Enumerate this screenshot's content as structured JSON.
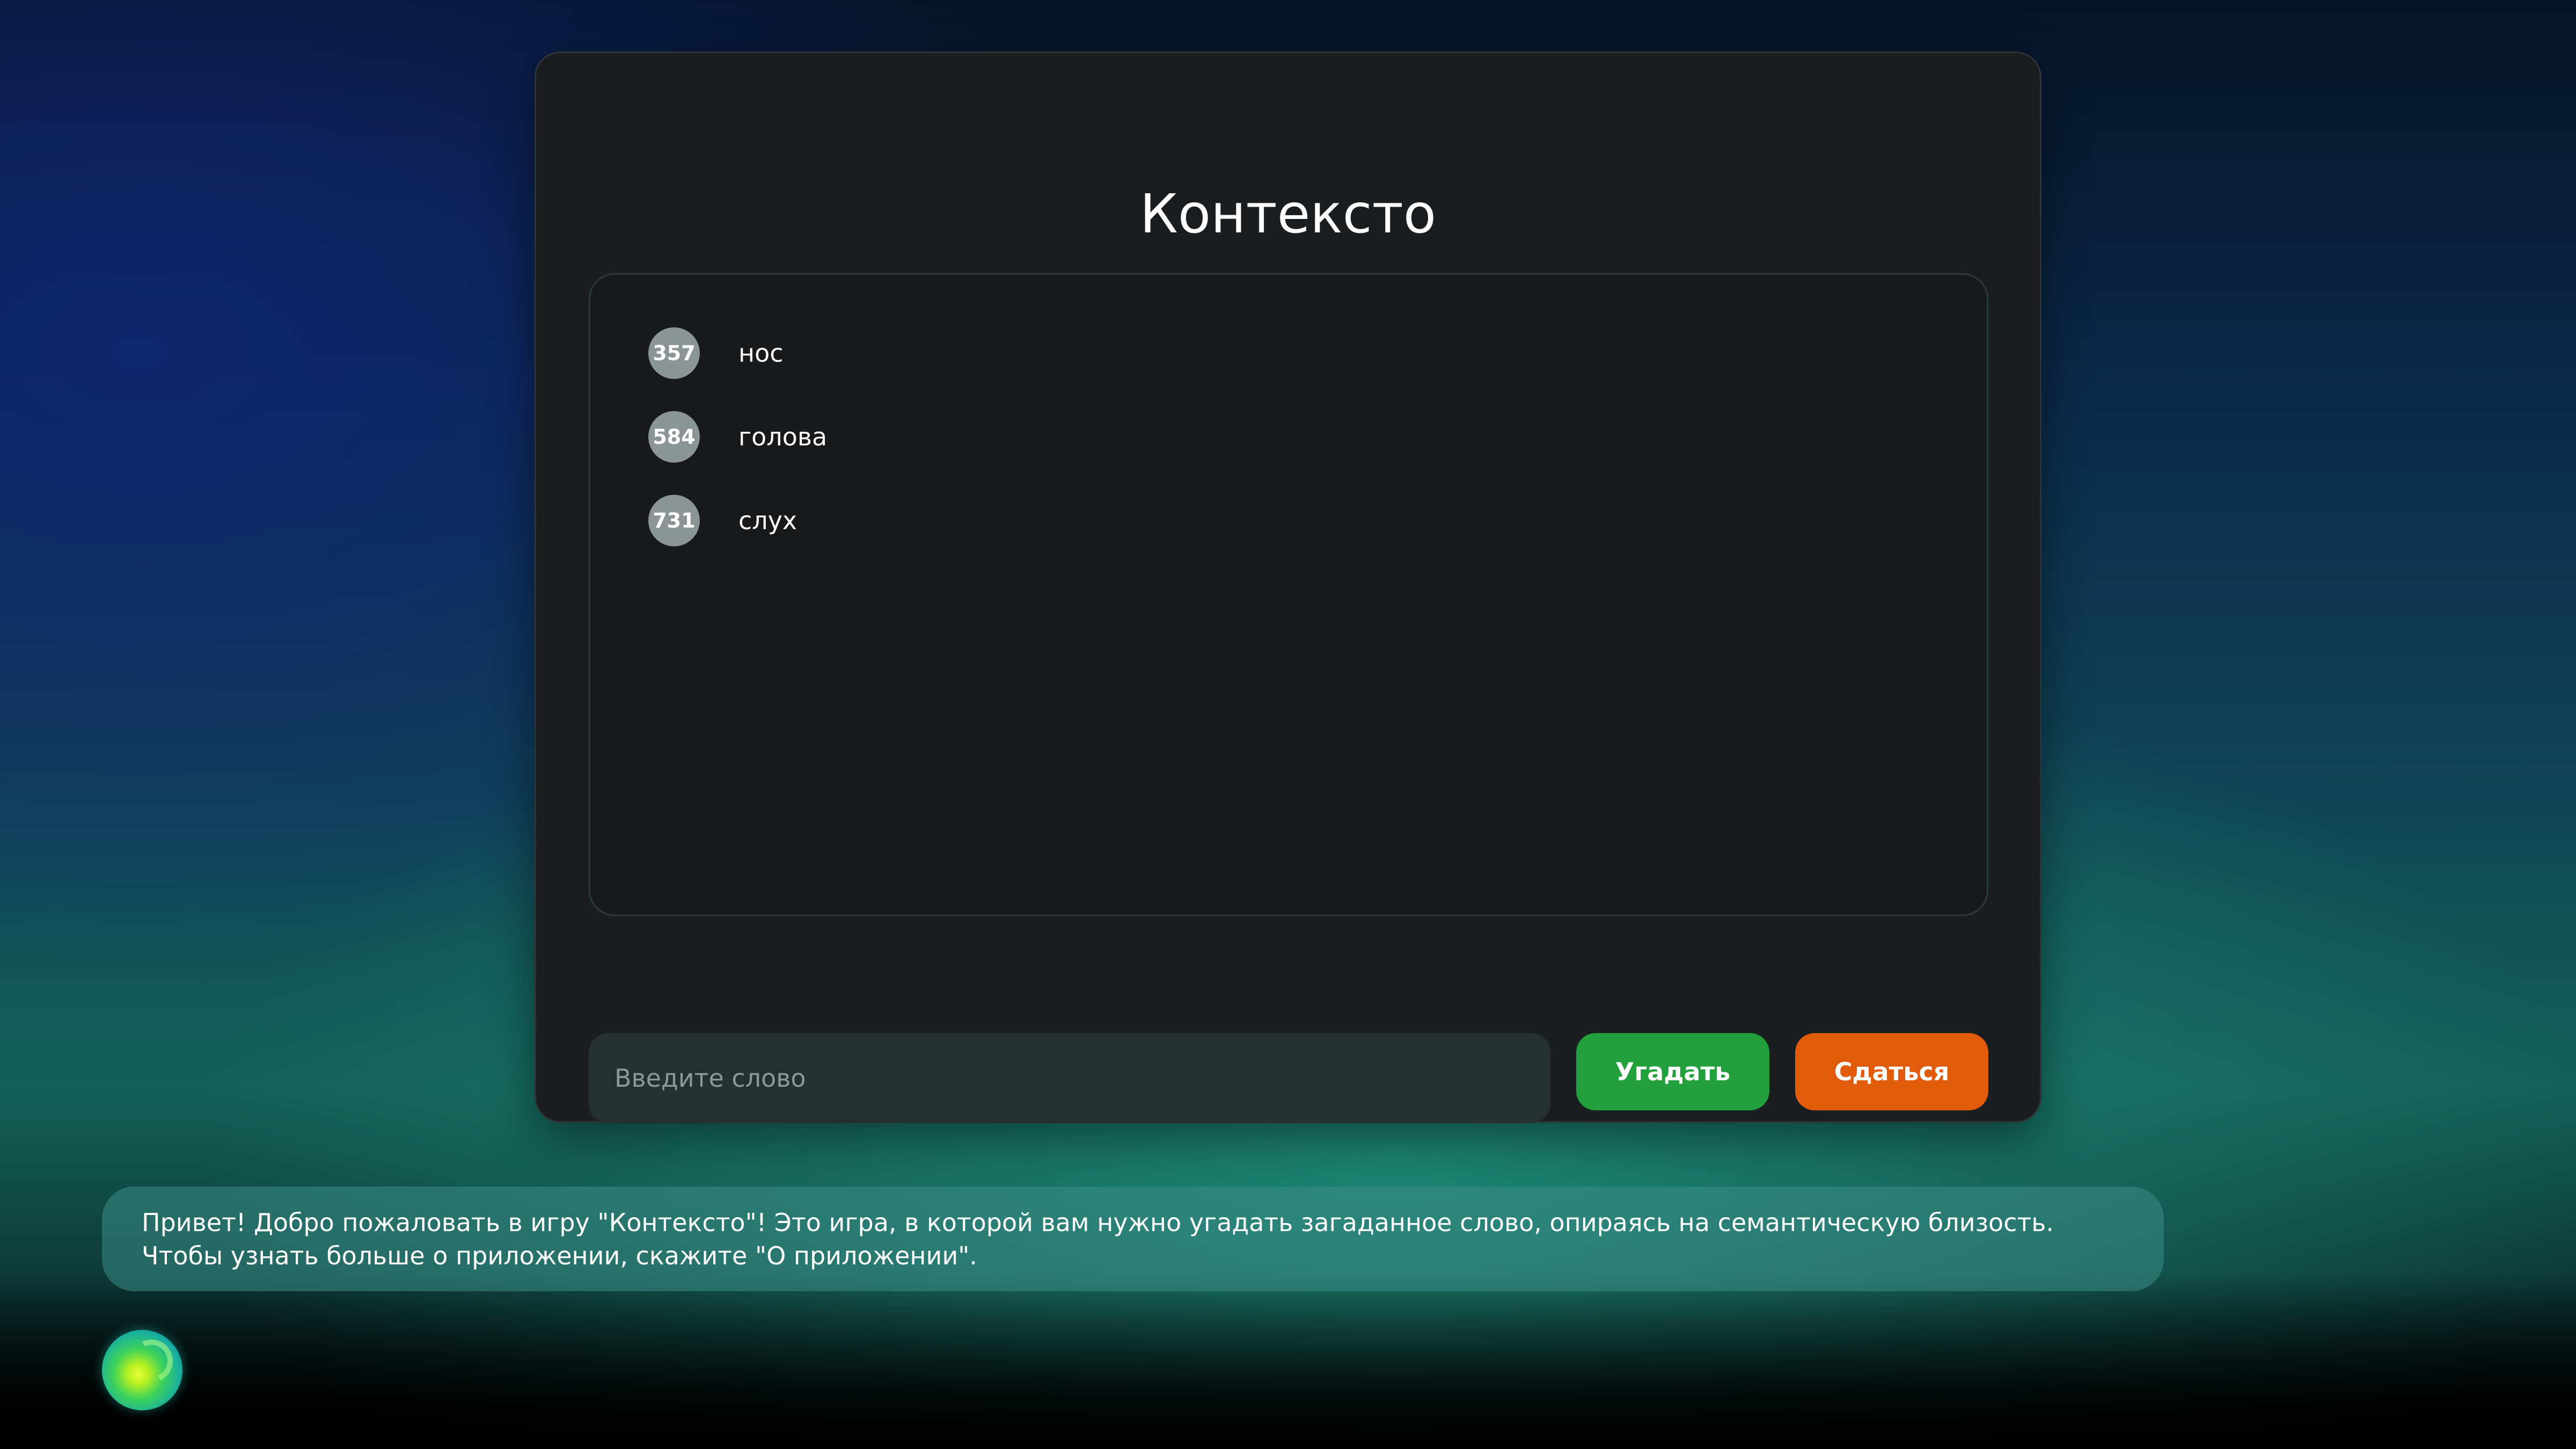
{
  "game": {
    "title": "Контексто",
    "guesses": [
      {
        "rank": "357",
        "word": "нос"
      },
      {
        "rank": "584",
        "word": "голова"
      },
      {
        "rank": "731",
        "word": "слух"
      }
    ],
    "input": {
      "placeholder": "Введите слово",
      "value": ""
    },
    "buttons": {
      "guess_label": "Угадать",
      "give_up_label": "Сдаться"
    }
  },
  "assistant": {
    "message_lines": [
      "Привет! Добро пожаловать в игру \"Контексто\"! Это игра, в которой вам нужно угадать загаданное слово, опираясь на семантическую близость.",
      "Чтобы узнать больше о приложении, скажите \"О приложении\"."
    ],
    "avatar_icon": "assistant-orb-icon"
  },
  "colors": {
    "guess_button": "#21a03c",
    "give_up_button": "#e25b0a",
    "rank_badge": "#8b9596",
    "card_background": "#1b1e20"
  }
}
